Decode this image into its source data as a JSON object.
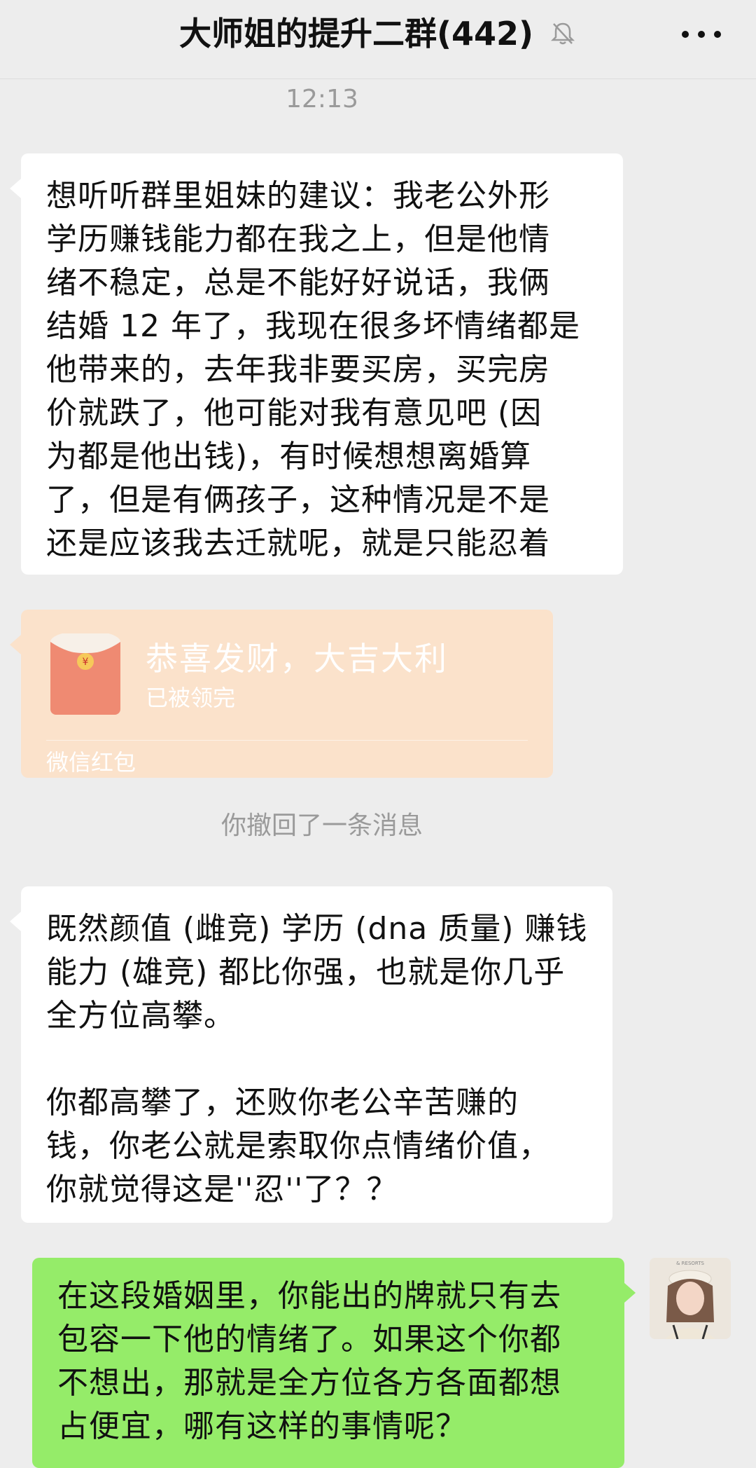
{
  "header": {
    "title": "大师姐的提升二群(442)",
    "mute_icon": "bell-off-icon",
    "more_icon": "more-dots-icon"
  },
  "timestamp": "12:13",
  "messages": [
    {
      "type": "text",
      "sender": "other",
      "text": "想听听群里姐妹的建议：我老公外形\n学历赚钱能力都在我之上，但是他情\n绪不稳定，总是不能好好说话，我俩\n结婚 12 年了，我现在很多坏情绪都是\n他带来的，去年我非要买房，买完房\n价就跌了，他可能对我有意见吧 (因\n为都是他出钱)，有时候想想离婚算\n了，但是有俩孩子，这种情况是不是\n还是应该我去迁就呢，就是只能忍着"
    },
    {
      "type": "red_packet",
      "sender": "other",
      "title": "恭喜发财，大吉大利",
      "status": "已被领完",
      "footer": "微信红包",
      "color": "#fbe2cb"
    },
    {
      "type": "system",
      "text": "你撤回了一条消息"
    },
    {
      "type": "text",
      "sender": "other",
      "text": "既然颜值 (雌竞) 学历 (dna 质量) 赚钱\n能力 (雄竞) 都比你强，也就是你几乎\n全方位高攀。\n\n你都高攀了，还败你老公辛苦赚的\n钱，你老公就是索取你点情绪价值，\n你就觉得这是''忍''了？？"
    },
    {
      "type": "text",
      "sender": "me",
      "text": "在这段婚姻里，你能出的牌就只有去\n包容一下他的情绪了。如果这个你都\n不想出，那就是全方位各方各面都想\n占便宜，哪有这样的事情呢？",
      "color": "#95ec69"
    }
  ]
}
